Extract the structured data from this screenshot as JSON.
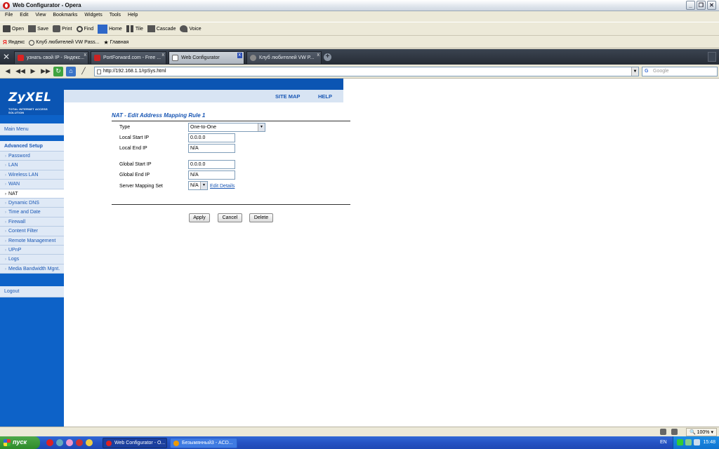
{
  "window": {
    "title": "Web Configurator - Opera"
  },
  "menu": [
    "File",
    "Edit",
    "View",
    "Bookmarks",
    "Widgets",
    "Tools",
    "Help"
  ],
  "toolbar": [
    {
      "label": "Open",
      "icon": "folder-open-icon"
    },
    {
      "label": "Save",
      "icon": "save-icon"
    },
    {
      "label": "Print",
      "icon": "print-icon"
    },
    {
      "label": "Find",
      "icon": "search-icon"
    },
    {
      "label": "Home",
      "icon": "home-icon"
    },
    {
      "label": "Tile",
      "icon": "tile-icon"
    },
    {
      "label": "Cascade",
      "icon": "cascade-icon"
    },
    {
      "label": "Voice",
      "icon": "voice-icon"
    }
  ],
  "bookmarks": [
    {
      "label": "Яндекс",
      "icon": "yandex-icon"
    },
    {
      "label": "Клуб любителей VW Pass...",
      "icon": "club-icon"
    },
    {
      "label": "Главная",
      "icon": "star-icon"
    }
  ],
  "tabs": [
    {
      "label": "узнать свой IP - Яндекс...",
      "active": false
    },
    {
      "label": "PortForward.com - Free ...",
      "active": false
    },
    {
      "label": "Web Configurator",
      "active": true
    },
    {
      "label": "Клуб любителей VW P...",
      "active": false
    }
  ],
  "address": {
    "url": "http://192.168.1.1/rpSys.html",
    "search_placeholder": "Google"
  },
  "brand": {
    "logo": "ZyXEL",
    "tagline": "TOTAL INTERNET ACCESS SOLUTION"
  },
  "header_links": {
    "site_map": "SITE MAP",
    "help": "HELP"
  },
  "nav": {
    "main_menu": "Main Menu",
    "advanced_setup": "Advanced Setup",
    "items": [
      "Password",
      "LAN",
      "Wireless LAN",
      "WAN",
      "NAT",
      "Dynamic DNS",
      "Time and Date",
      "Firewall",
      "Content Filter",
      "Remote Management",
      "UPnP",
      "Logs",
      "Media Bandwidth Mgnt."
    ],
    "current": "NAT",
    "logout": "Logout"
  },
  "form": {
    "title": "NAT - Edit Address Mapping Rule 1",
    "type_label": "Type",
    "type_value": "One-to-One",
    "local_start_label": "Local Start IP",
    "local_start_value": "0.0.0.0",
    "local_end_label": "Local End IP",
    "local_end_value": "N/A",
    "global_start_label": "Global Start IP",
    "global_start_value": "0.0.0.0",
    "global_end_label": "Global End IP",
    "global_end_value": "N/A",
    "server_mapping_label": "Server Mapping Set",
    "server_mapping_value": "N/A",
    "edit_details": "Edit Details",
    "apply": "Apply",
    "cancel": "Cancel",
    "delete": "Delete"
  },
  "statusbar": {
    "zoom": "100%"
  },
  "taskbar": {
    "start": "пуск",
    "tasks": [
      {
        "label": "Web Configurator - O...",
        "active": true
      },
      {
        "label": "Безымянный3 - ACD...",
        "active": false
      }
    ],
    "lang": "EN",
    "clock": "15:48"
  },
  "colors": {
    "zyxel_blue": "#0d62c8",
    "link_blue": "#1a57b4",
    "nav_bg": "#dfe9f6",
    "taskbar_blue": "#2553c4",
    "start_green": "#3c9a38"
  }
}
